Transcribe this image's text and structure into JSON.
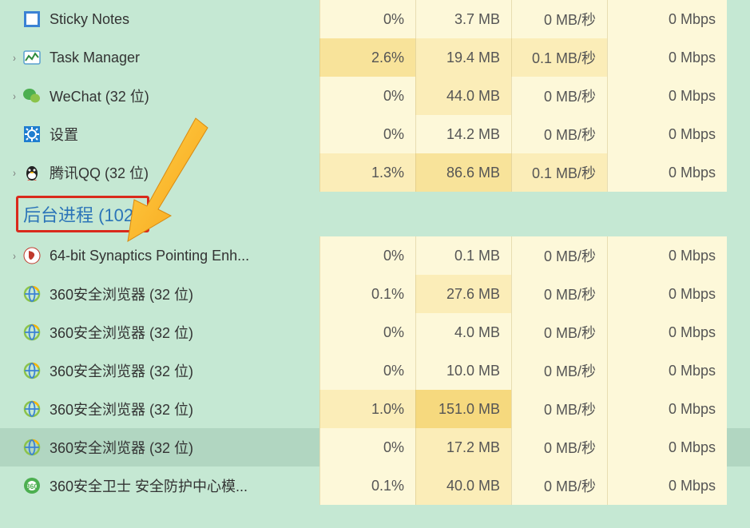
{
  "section_header": "后台进程 (102)",
  "rows": [
    {
      "icon": "sticky",
      "expand": "",
      "name": "Sticky Notes",
      "cpu": "0%",
      "mem": "3.7 MB",
      "disk": "0 MB/秒",
      "net": "0 Mbps",
      "cpu_h": 0,
      "mem_h": 0,
      "disk_h": 0,
      "net_h": 0
    },
    {
      "icon": "taskmgr",
      "expand": ">",
      "name": "Task Manager",
      "cpu": "2.6%",
      "mem": "19.4 MB",
      "disk": "0.1 MB/秒",
      "net": "0 Mbps",
      "cpu_h": 2,
      "mem_h": 1,
      "disk_h": 1,
      "net_h": 0
    },
    {
      "icon": "wechat",
      "expand": ">",
      "name": "WeChat (32 位)",
      "cpu": "0%",
      "mem": "44.0 MB",
      "disk": "0 MB/秒",
      "net": "0 Mbps",
      "cpu_h": 0,
      "mem_h": 1,
      "disk_h": 0,
      "net_h": 0
    },
    {
      "icon": "settings",
      "expand": "",
      "name": "设置",
      "cpu": "0%",
      "mem": "14.2 MB",
      "disk": "0 MB/秒",
      "net": "0 Mbps",
      "cpu_h": 0,
      "mem_h": 0,
      "disk_h": 0,
      "net_h": 0
    },
    {
      "icon": "qq",
      "expand": ">",
      "name": "腾讯QQ (32 位)",
      "cpu": "1.3%",
      "mem": "86.6 MB",
      "disk": "0.1 MB/秒",
      "net": "0 Mbps",
      "cpu_h": 1,
      "mem_h": 2,
      "disk_h": 1,
      "net_h": 0
    }
  ],
  "rows2": [
    {
      "icon": "synaptics",
      "expand": ">",
      "name": "64-bit Synaptics Pointing Enh...",
      "cpu": "0%",
      "mem": "0.1 MB",
      "disk": "0 MB/秒",
      "net": "0 Mbps",
      "cpu_h": 0,
      "mem_h": 0,
      "disk_h": 0,
      "net_h": 0,
      "sel": false
    },
    {
      "icon": "browser",
      "expand": "",
      "name": "360安全浏览器 (32 位)",
      "cpu": "0.1%",
      "mem": "27.6 MB",
      "disk": "0 MB/秒",
      "net": "0 Mbps",
      "cpu_h": 0,
      "mem_h": 1,
      "disk_h": 0,
      "net_h": 0,
      "sel": false
    },
    {
      "icon": "browser",
      "expand": "",
      "name": "360安全浏览器 (32 位)",
      "cpu": "0%",
      "mem": "4.0 MB",
      "disk": "0 MB/秒",
      "net": "0 Mbps",
      "cpu_h": 0,
      "mem_h": 0,
      "disk_h": 0,
      "net_h": 0,
      "sel": false
    },
    {
      "icon": "browser",
      "expand": "",
      "name": "360安全浏览器 (32 位)",
      "cpu": "0%",
      "mem": "10.0 MB",
      "disk": "0 MB/秒",
      "net": "0 Mbps",
      "cpu_h": 0,
      "mem_h": 0,
      "disk_h": 0,
      "net_h": 0,
      "sel": false
    },
    {
      "icon": "browser",
      "expand": "",
      "name": "360安全浏览器 (32 位)",
      "cpu": "1.0%",
      "mem": "151.0 MB",
      "disk": "0 MB/秒",
      "net": "0 Mbps",
      "cpu_h": 1,
      "mem_h": 3,
      "disk_h": 0,
      "net_h": 0,
      "sel": false
    },
    {
      "icon": "browser",
      "expand": "",
      "name": "360安全浏览器 (32 位)",
      "cpu": "0%",
      "mem": "17.2 MB",
      "disk": "0 MB/秒",
      "net": "0 Mbps",
      "cpu_h": 0,
      "mem_h": 1,
      "disk_h": 0,
      "net_h": 0,
      "sel": true
    },
    {
      "icon": "guard",
      "expand": "",
      "name": "360安全卫士 安全防护中心模...",
      "cpu": "0.1%",
      "mem": "40.0 MB",
      "disk": "0 MB/秒",
      "net": "0 Mbps",
      "cpu_h": 0,
      "mem_h": 1,
      "disk_h": 0,
      "net_h": 0,
      "sel": false
    }
  ]
}
